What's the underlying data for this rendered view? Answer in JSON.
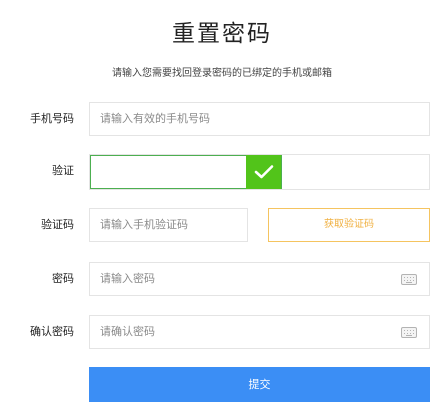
{
  "page": {
    "title": "重置密码",
    "subtitle": "请输入您需要找回登录密码的已绑定的手机或邮箱"
  },
  "form": {
    "phone": {
      "label": "手机号码",
      "placeholder": "请输入有效的手机号码"
    },
    "verify": {
      "label": "验证",
      "status": "verified",
      "icon": "checkmark-icon"
    },
    "sms_code": {
      "label": "验证码",
      "placeholder": "请输入手机验证码",
      "get_code_label": "获取验证码"
    },
    "password": {
      "label": "密码",
      "placeholder": "请输入密码",
      "icon": "keyboard-icon"
    },
    "confirm_password": {
      "label": "确认密码",
      "placeholder": "请确认密码",
      "icon": "keyboard-icon"
    },
    "submit_label": "提交"
  },
  "colors": {
    "primary": "#3b8ef5",
    "success": "#52c41a",
    "warning": "#f0b040"
  }
}
